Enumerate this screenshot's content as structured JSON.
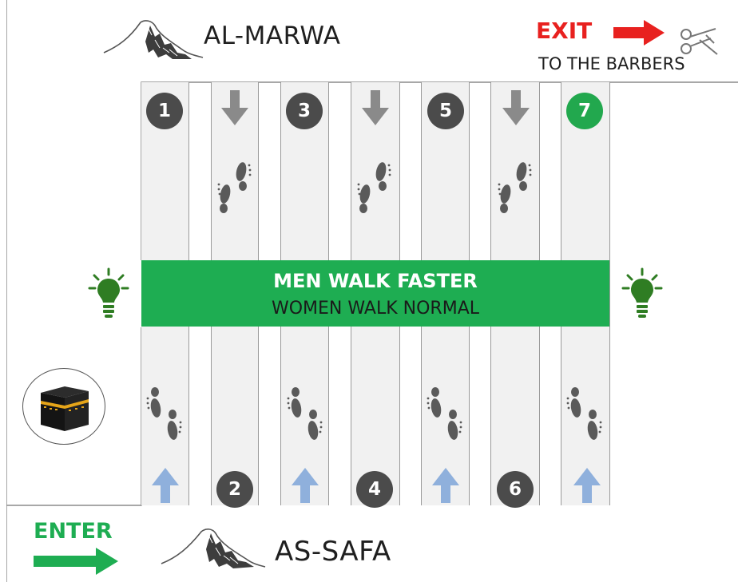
{
  "top": {
    "destination": "AL-MARWA",
    "exit_label": "EXIT",
    "exit_sub": "TO THE BARBERS"
  },
  "bottom": {
    "origin": "AS-SAFA",
    "enter_label": "ENTER"
  },
  "banner": {
    "line1": "MEN WALK FASTER",
    "line2": "WOMEN WALK NORMAL"
  },
  "laps": [
    {
      "number": "1",
      "end": "top"
    },
    {
      "number": "2",
      "end": "bottom"
    },
    {
      "number": "3",
      "end": "top"
    },
    {
      "number": "4",
      "end": "bottom"
    },
    {
      "number": "5",
      "end": "top"
    },
    {
      "number": "6",
      "end": "bottom"
    },
    {
      "number": "7",
      "end": "top",
      "final": true
    }
  ],
  "colors": {
    "banner": "#1ead52",
    "final_lap": "#22a84e",
    "lap_marker": "#4b4b4b",
    "exit": "#e8211f",
    "enter": "#1ead52",
    "up_arrow": "#8fb0dc",
    "down_arrow": "#8a8a8a",
    "light": "#2f7d23"
  },
  "icons": [
    "mountain-icon",
    "exit-arrow-icon",
    "scissors-icon",
    "enter-arrow-icon",
    "footprints-icon",
    "up-arrow-icon",
    "down-arrow-icon",
    "light-bulb-icon",
    "kaaba-icon"
  ]
}
